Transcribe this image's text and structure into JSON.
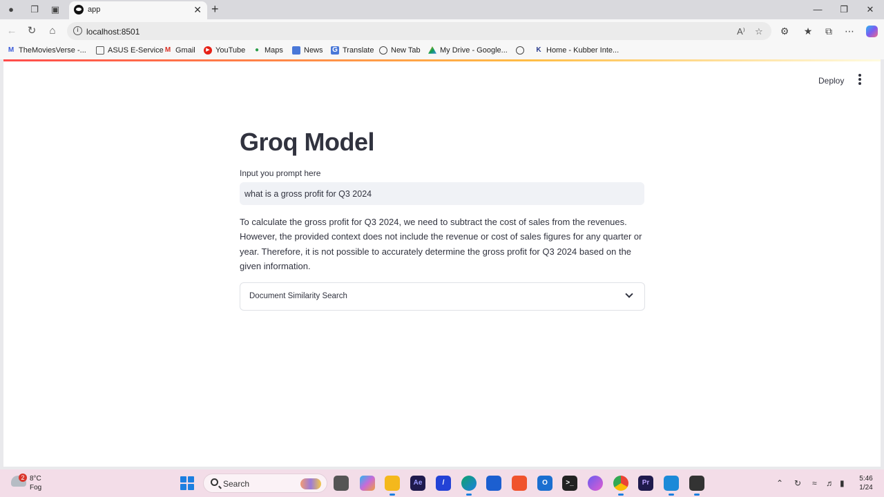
{
  "browser": {
    "tab_title": "app",
    "url": "localhost:8501",
    "bookmarks": [
      {
        "label": "TheMoviesVerse -...",
        "icon": "M"
      },
      {
        "label": "ASUS E-Service",
        "icon": "folder-icon"
      },
      {
        "label": "Gmail",
        "icon": "M"
      },
      {
        "label": "YouTube",
        "icon": "play-icon"
      },
      {
        "label": "Maps",
        "icon": "map-pin-icon"
      },
      {
        "label": "News",
        "icon": "news-icon"
      },
      {
        "label": "Translate",
        "icon": "translate-icon"
      },
      {
        "label": "New Tab",
        "icon": "globe-icon"
      },
      {
        "label": "My Drive - Google...",
        "icon": "drive-icon"
      },
      {
        "label": "",
        "icon": "globe-icon"
      },
      {
        "label": "Home - Kubber Inte...",
        "icon": "K"
      }
    ]
  },
  "app": {
    "deploy_label": "Deploy",
    "title": "Groq Model",
    "input_label": "Input you prompt here",
    "input_value": "what is a gross profit for Q3 2024",
    "answer": "To calculate the gross profit for Q3 2024, we need to subtract the cost of sales from the revenues. However, the provided context does not include the revenue or cost of sales figures for any quarter or year. Therefore, it is not possible to accurately determine the gross profit for Q3 2024 based on the given information.",
    "expander_label": "Document Similarity Search"
  },
  "taskbar": {
    "weather_badge": "2",
    "temperature": "8°C",
    "condition": "Fog",
    "search_label": "Search",
    "time": "5:46",
    "date": "1/24"
  },
  "colors": {
    "text": "#31333f",
    "input_bg": "#f0f2f6",
    "accent_start": "#ff4b4b",
    "accent_end": "#ffbd45"
  }
}
